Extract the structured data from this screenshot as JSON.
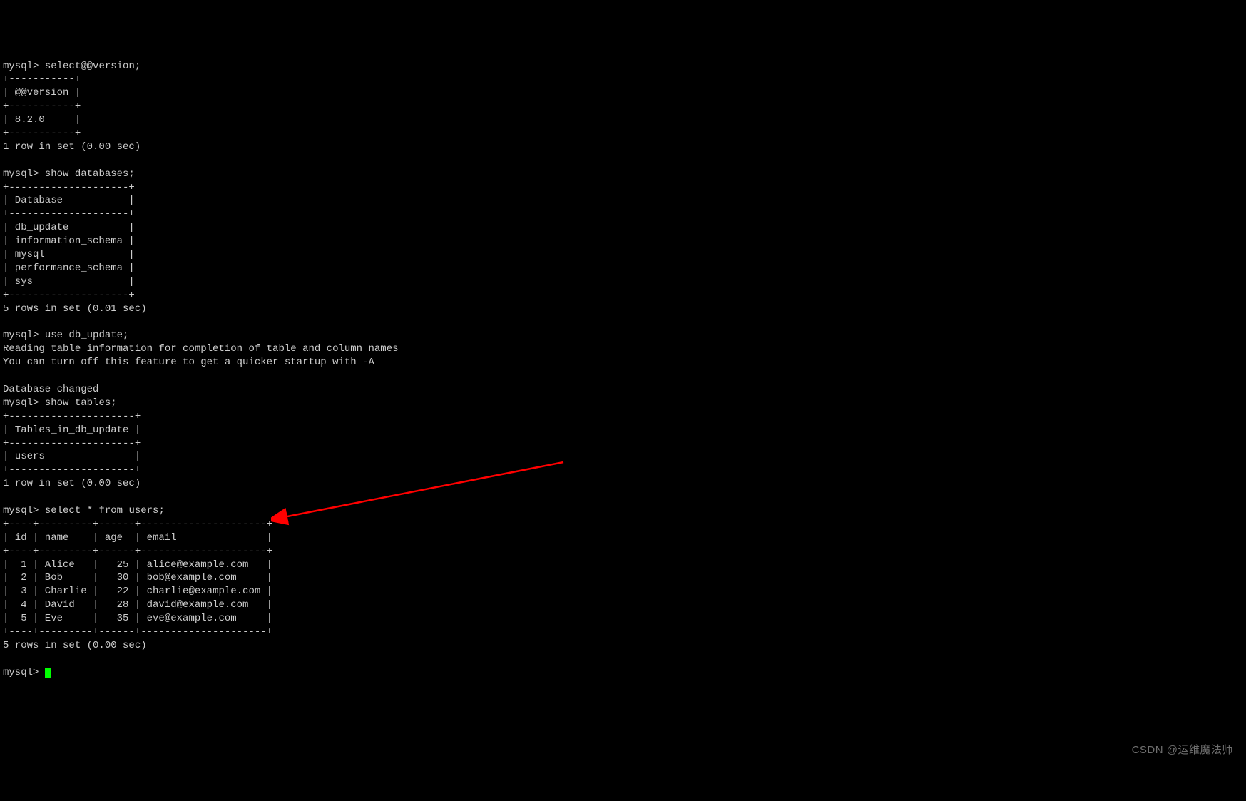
{
  "prompt": "mysql>",
  "cmd1": "select@@version;",
  "version_table": {
    "border_top": "+-----------+",
    "header": "| @@version |",
    "border_mid": "+-----------+",
    "row": "| 8.2.0     |",
    "border_bot": "+-----------+",
    "footer": "1 row in set (0.00 sec)"
  },
  "cmd2": "show databases;",
  "db_table": {
    "border_top": "+--------------------+",
    "header": "| Database           |",
    "border_mid": "+--------------------+",
    "rows": [
      "| db_update          |",
      "| information_schema |",
      "| mysql              |",
      "| performance_schema |",
      "| sys                |"
    ],
    "border_bot": "+--------------------+",
    "footer": "5 rows in set (0.01 sec)"
  },
  "cmd3": "use db_update;",
  "use_msg1": "Reading table information for completion of table and column names",
  "use_msg2": "You can turn off this feature to get a quicker startup with -A",
  "db_changed": "Database changed",
  "cmd4": "show tables;",
  "tables_table": {
    "border_top": "+---------------------+",
    "header": "| Tables_in_db_update |",
    "border_mid": "+---------------------+",
    "row": "| users               |",
    "border_bot": "+---------------------+",
    "footer": "1 row in set (0.00 sec)"
  },
  "cmd5": "select * from users;",
  "users_table": {
    "border": "+----+---------+------+---------------------+",
    "header": "| id | name    | age  | email               |",
    "rows": [
      "|  1 | Alice   |   25 | alice@example.com   |",
      "|  2 | Bob     |   30 | bob@example.com     |",
      "|  3 | Charlie |   22 | charlie@example.com |",
      "|  4 | David   |   28 | david@example.com   |",
      "|  5 | Eve     |   35 | eve@example.com     |"
    ],
    "footer": "5 rows in set (0.00 sec)"
  },
  "watermark": "CSDN @运维魔法师"
}
